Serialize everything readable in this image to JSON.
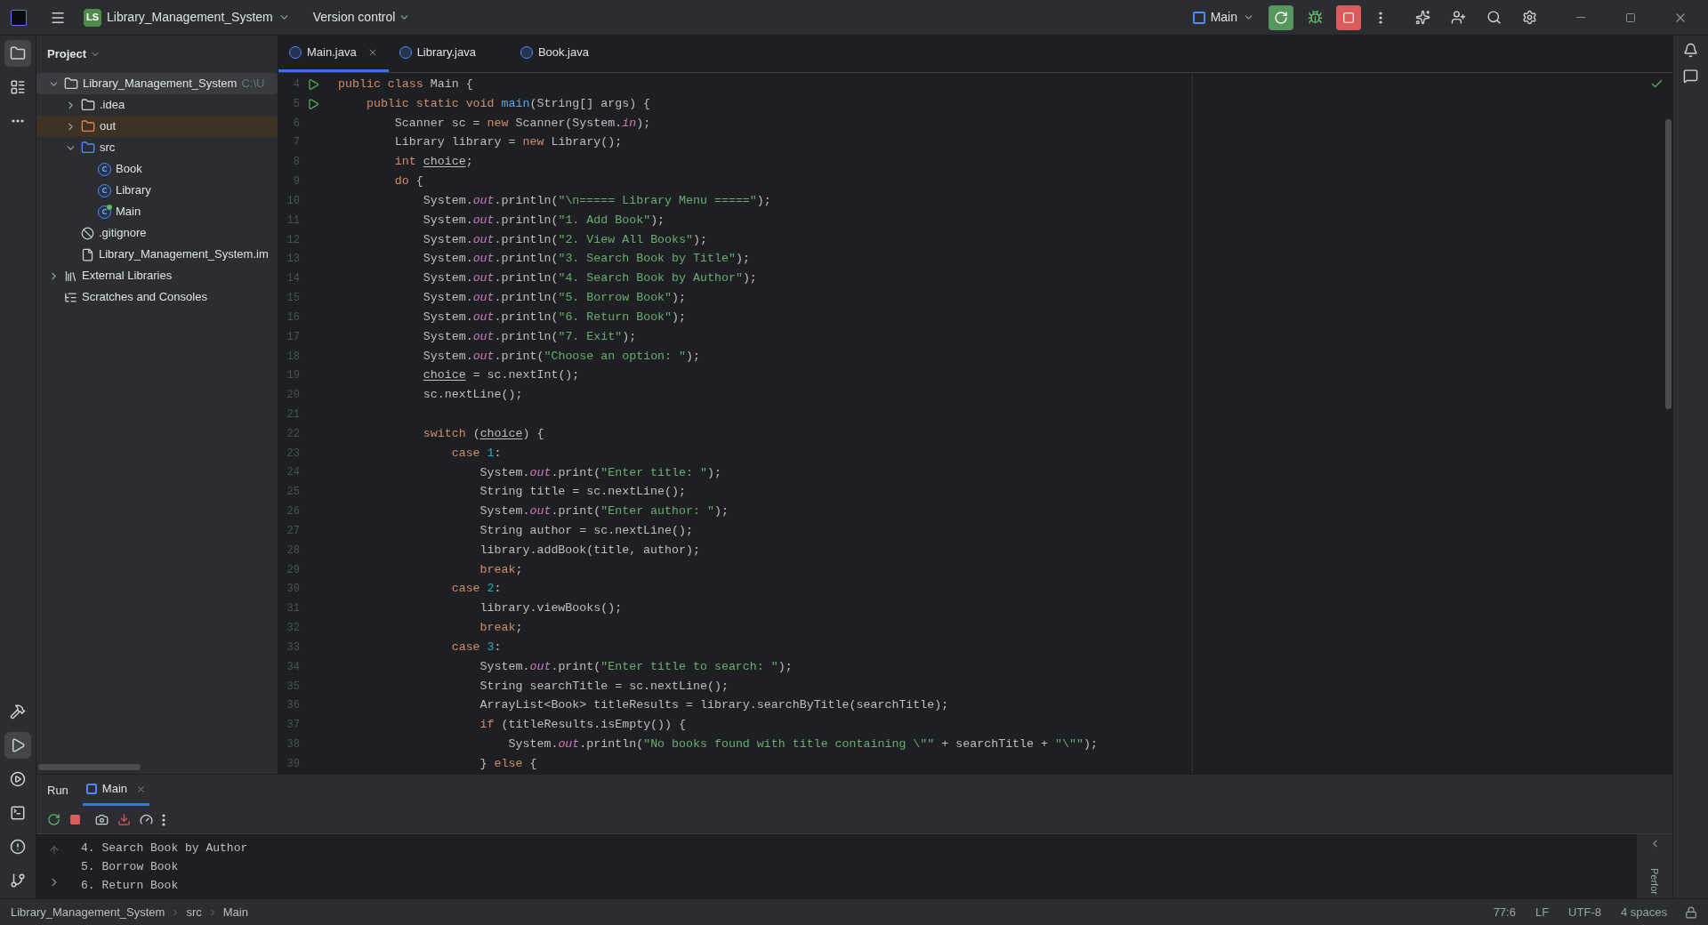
{
  "title_bar": {
    "project_badge": "LS",
    "project_name": "Library_Management_System",
    "vcs": "Version control",
    "run_config": "Main"
  },
  "left_toolbar": [
    {
      "kind": "folder",
      "selected": true
    },
    {
      "kind": "structure",
      "selected": false
    },
    {
      "kind": "more",
      "selected": false
    }
  ],
  "left_toolbar_bottom": [
    {
      "kind": "build",
      "selected": false
    },
    {
      "kind": "run",
      "selected": true
    },
    {
      "kind": "services",
      "selected": false
    },
    {
      "kind": "terminal",
      "selected": false
    },
    {
      "kind": "problems",
      "selected": false
    },
    {
      "kind": "git",
      "selected": false
    }
  ],
  "project_panel": {
    "title": "Project",
    "tree": [
      {
        "label": "Library_Management_System",
        "hint": "C:\\U",
        "kind": "module",
        "expanded": true,
        "selected": true,
        "children": [
          {
            "label": ".idea",
            "kind": "folder",
            "expanded": false,
            "selected": false
          },
          {
            "label": "out",
            "kind": "excluded",
            "expanded": false,
            "selected": false
          },
          {
            "label": "src",
            "kind": "source",
            "expanded": true,
            "selected": false,
            "children": [
              {
                "label": "Book",
                "kind": "class",
                "selected": false
              },
              {
                "label": "Library",
                "kind": "class",
                "selected": false
              },
              {
                "label": "Main",
                "kind": "main",
                "selected": false
              }
            ]
          },
          {
            "label": ".gitignore",
            "kind": "ignore",
            "selected": false
          },
          {
            "label": "Library_Management_System.im",
            "kind": "file",
            "selected": false
          }
        ]
      },
      {
        "label": "External Libraries",
        "kind": "libraries",
        "expanded": false,
        "selected": false
      },
      {
        "label": "Scratches and Consoles",
        "kind": "scratches",
        "selected": false
      }
    ]
  },
  "editor_tabs": [
    {
      "label": "Main.java",
      "selected": true
    },
    {
      "label": "Library.java",
      "selected": false
    },
    {
      "label": "Book.java",
      "selected": false
    }
  ],
  "code_lines": [
    {
      "number": "4",
      "runnable": true,
      "tokens": [
        {
          "kind": "keyword",
          "text": "public class "
        },
        {
          "kind": "plain",
          "text": "Main {"
        }
      ]
    },
    {
      "number": "5",
      "runnable": true,
      "tokens": [
        {
          "kind": "keyword",
          "text": "    public static void "
        },
        {
          "kind": "method",
          "text": "main"
        },
        {
          "kind": "plain",
          "text": "(String[] args) {"
        }
      ]
    },
    {
      "number": "6",
      "runnable": false,
      "tokens": [
        {
          "kind": "plain",
          "text": "        Scanner sc = "
        },
        {
          "kind": "keyword",
          "text": "new"
        },
        {
          "kind": "plain",
          "text": " Scanner(System."
        },
        {
          "kind": "field",
          "text": "in"
        },
        {
          "kind": "plain",
          "text": ");"
        }
      ]
    },
    {
      "number": "7",
      "runnable": false,
      "tokens": [
        {
          "kind": "plain",
          "text": "        Library library = "
        },
        {
          "kind": "keyword",
          "text": "new"
        },
        {
          "kind": "plain",
          "text": " Library();"
        }
      ]
    },
    {
      "number": "8",
      "runnable": false,
      "tokens": [
        {
          "kind": "keyword",
          "text": "        int "
        },
        {
          "kind": "variable",
          "text": "choice"
        },
        {
          "kind": "plain",
          "text": ";"
        }
      ]
    },
    {
      "number": "9",
      "runnable": false,
      "tokens": [
        {
          "kind": "keyword",
          "text": "        do"
        },
        {
          "kind": "plain",
          "text": " {"
        }
      ]
    },
    {
      "number": "10",
      "runnable": false,
      "tokens": [
        {
          "kind": "plain",
          "text": "            System."
        },
        {
          "kind": "field",
          "text": "out"
        },
        {
          "kind": "plain",
          "text": ".println("
        },
        {
          "kind": "string",
          "text": "\"\\n===== Library Menu =====\""
        },
        {
          "kind": "plain",
          "text": ");"
        }
      ]
    },
    {
      "number": "11",
      "runnable": false,
      "tokens": [
        {
          "kind": "plain",
          "text": "            System."
        },
        {
          "kind": "field",
          "text": "out"
        },
        {
          "kind": "plain",
          "text": ".println("
        },
        {
          "kind": "string",
          "text": "\"1. Add Book\""
        },
        {
          "kind": "plain",
          "text": ");"
        }
      ]
    },
    {
      "number": "12",
      "runnable": false,
      "tokens": [
        {
          "kind": "plain",
          "text": "            System."
        },
        {
          "kind": "field",
          "text": "out"
        },
        {
          "kind": "plain",
          "text": ".println("
        },
        {
          "kind": "string",
          "text": "\"2. View All Books\""
        },
        {
          "kind": "plain",
          "text": ");"
        }
      ]
    },
    {
      "number": "13",
      "runnable": false,
      "tokens": [
        {
          "kind": "plain",
          "text": "            System."
        },
        {
          "kind": "field",
          "text": "out"
        },
        {
          "kind": "plain",
          "text": ".println("
        },
        {
          "kind": "string",
          "text": "\"3. Search Book by Title\""
        },
        {
          "kind": "plain",
          "text": ");"
        }
      ]
    },
    {
      "number": "14",
      "runnable": false,
      "tokens": [
        {
          "kind": "plain",
          "text": "            System."
        },
        {
          "kind": "field",
          "text": "out"
        },
        {
          "kind": "plain",
          "text": ".println("
        },
        {
          "kind": "string",
          "text": "\"4. Search Book by Author\""
        },
        {
          "kind": "plain",
          "text": ");"
        }
      ]
    },
    {
      "number": "15",
      "runnable": false,
      "tokens": [
        {
          "kind": "plain",
          "text": "            System."
        },
        {
          "kind": "field",
          "text": "out"
        },
        {
          "kind": "plain",
          "text": ".println("
        },
        {
          "kind": "string",
          "text": "\"5. Borrow Book\""
        },
        {
          "kind": "plain",
          "text": ");"
        }
      ]
    },
    {
      "number": "16",
      "runnable": false,
      "tokens": [
        {
          "kind": "plain",
          "text": "            System."
        },
        {
          "kind": "field",
          "text": "out"
        },
        {
          "kind": "plain",
          "text": ".println("
        },
        {
          "kind": "string",
          "text": "\"6. Return Book\""
        },
        {
          "kind": "plain",
          "text": ");"
        }
      ]
    },
    {
      "number": "17",
      "runnable": false,
      "tokens": [
        {
          "kind": "plain",
          "text": "            System."
        },
        {
          "kind": "field",
          "text": "out"
        },
        {
          "kind": "plain",
          "text": ".println("
        },
        {
          "kind": "string",
          "text": "\"7. Exit\""
        },
        {
          "kind": "plain",
          "text": ");"
        }
      ]
    },
    {
      "number": "18",
      "runnable": false,
      "tokens": [
        {
          "kind": "plain",
          "text": "            System."
        },
        {
          "kind": "field",
          "text": "out"
        },
        {
          "kind": "plain",
          "text": ".print("
        },
        {
          "kind": "string",
          "text": "\"Choose an option: \""
        },
        {
          "kind": "plain",
          "text": ");"
        }
      ]
    },
    {
      "number": "19",
      "runnable": false,
      "tokens": [
        {
          "kind": "variable",
          "text": "            choice"
        },
        {
          "kind": "plain",
          "text": " = sc.nextInt();"
        }
      ]
    },
    {
      "number": "20",
      "runnable": false,
      "tokens": [
        {
          "kind": "plain",
          "text": "            sc.nextLine();"
        }
      ]
    },
    {
      "number": "21",
      "runnable": false
    },
    {
      "number": "22",
      "runnable": false,
      "tokens": [
        {
          "kind": "keyword",
          "text": "            switch"
        },
        {
          "kind": "plain",
          "text": " ("
        },
        {
          "kind": "variable",
          "text": "choice"
        },
        {
          "kind": "plain",
          "text": ") {"
        }
      ]
    },
    {
      "number": "23",
      "runnable": false,
      "tokens": [
        {
          "kind": "keyword",
          "text": "                case "
        },
        {
          "kind": "number",
          "text": "1"
        },
        {
          "kind": "plain",
          "text": ":"
        }
      ]
    },
    {
      "number": "24",
      "runnable": false,
      "tokens": [
        {
          "kind": "plain",
          "text": "                    System."
        },
        {
          "kind": "field",
          "text": "out"
        },
        {
          "kind": "plain",
          "text": ".print("
        },
        {
          "kind": "string",
          "text": "\"Enter title: \""
        },
        {
          "kind": "plain",
          "text": ");"
        }
      ]
    },
    {
      "number": "25",
      "runnable": false,
      "tokens": [
        {
          "kind": "plain",
          "text": "                    String title = sc.nextLine();"
        }
      ]
    },
    {
      "number": "26",
      "runnable": false,
      "tokens": [
        {
          "kind": "plain",
          "text": "                    System."
        },
        {
          "kind": "field",
          "text": "out"
        },
        {
          "kind": "plain",
          "text": ".print("
        },
        {
          "kind": "string",
          "text": "\"Enter author: \""
        },
        {
          "kind": "plain",
          "text": ");"
        }
      ]
    },
    {
      "number": "27",
      "runnable": false,
      "tokens": [
        {
          "kind": "plain",
          "text": "                    String author = sc.nextLine();"
        }
      ]
    },
    {
      "number": "28",
      "runnable": false,
      "tokens": [
        {
          "kind": "plain",
          "text": "                    library.addBook(title, author);"
        }
      ]
    },
    {
      "number": "29",
      "runnable": false,
      "tokens": [
        {
          "kind": "keyword",
          "text": "                    break"
        },
        {
          "kind": "plain",
          "text": ";"
        }
      ]
    },
    {
      "number": "30",
      "runnable": false,
      "tokens": [
        {
          "kind": "keyword",
          "text": "                case "
        },
        {
          "kind": "number",
          "text": "2"
        },
        {
          "kind": "plain",
          "text": ":"
        }
      ]
    },
    {
      "number": "31",
      "runnable": false,
      "tokens": [
        {
          "kind": "plain",
          "text": "                    library.viewBooks();"
        }
      ]
    },
    {
      "number": "32",
      "runnable": false,
      "tokens": [
        {
          "kind": "keyword",
          "text": "                    break"
        },
        {
          "kind": "plain",
          "text": ";"
        }
      ]
    },
    {
      "number": "33",
      "runnable": false,
      "tokens": [
        {
          "kind": "keyword",
          "text": "                case "
        },
        {
          "kind": "number",
          "text": "3"
        },
        {
          "kind": "plain",
          "text": ":"
        }
      ]
    },
    {
      "number": "34",
      "runnable": false,
      "tokens": [
        {
          "kind": "plain",
          "text": "                    System."
        },
        {
          "kind": "field",
          "text": "out"
        },
        {
          "kind": "plain",
          "text": ".print("
        },
        {
          "kind": "string",
          "text": "\"Enter title to search: \""
        },
        {
          "kind": "plain",
          "text": ");"
        }
      ]
    },
    {
      "number": "35",
      "runnable": false,
      "tokens": [
        {
          "kind": "plain",
          "text": "                    String searchTitle = sc.nextLine();"
        }
      ]
    },
    {
      "number": "36",
      "runnable": false,
      "tokens": [
        {
          "kind": "plain",
          "text": "                    ArrayList<Book> titleResults = library.searchByTitle(searchTitle);"
        }
      ]
    },
    {
      "number": "37",
      "runnable": false,
      "tokens": [
        {
          "kind": "keyword",
          "text": "                    if"
        },
        {
          "kind": "plain",
          "text": " (titleResults.isEmpty()) {"
        }
      ]
    },
    {
      "number": "38",
      "runnable": false,
      "tokens": [
        {
          "kind": "plain",
          "text": "                        System."
        },
        {
          "kind": "field",
          "text": "out"
        },
        {
          "kind": "plain",
          "text": ".println("
        },
        {
          "kind": "string",
          "text": "\"No books found with title containing \\\"\""
        },
        {
          "kind": "plain",
          "text": " + searchTitle + "
        },
        {
          "kind": "string",
          "text": "\"\\\"\""
        },
        {
          "kind": "plain",
          "text": ");"
        }
      ]
    },
    {
      "number": "39",
      "runnable": false,
      "tokens": [
        {
          "kind": "plain",
          "text": "                    } "
        },
        {
          "kind": "keyword",
          "text": "else"
        },
        {
          "kind": "plain",
          "text": " {"
        }
      ]
    }
  ],
  "run_panel": {
    "title": "Run",
    "tabs": [
      {
        "label": "Main",
        "selected": true
      }
    ],
    "console_lines": [
      "4. Search Book by Author",
      "5. Borrow Book",
      "6. Return Book"
    ],
    "side_label": "Perfor"
  },
  "status_bar": {
    "breadcrumbs": [
      "Library_Management_System",
      "src",
      "Main"
    ],
    "position": "77:6",
    "line_separator": "LF",
    "encoding": "UTF-8",
    "indent": "4 spaces"
  }
}
